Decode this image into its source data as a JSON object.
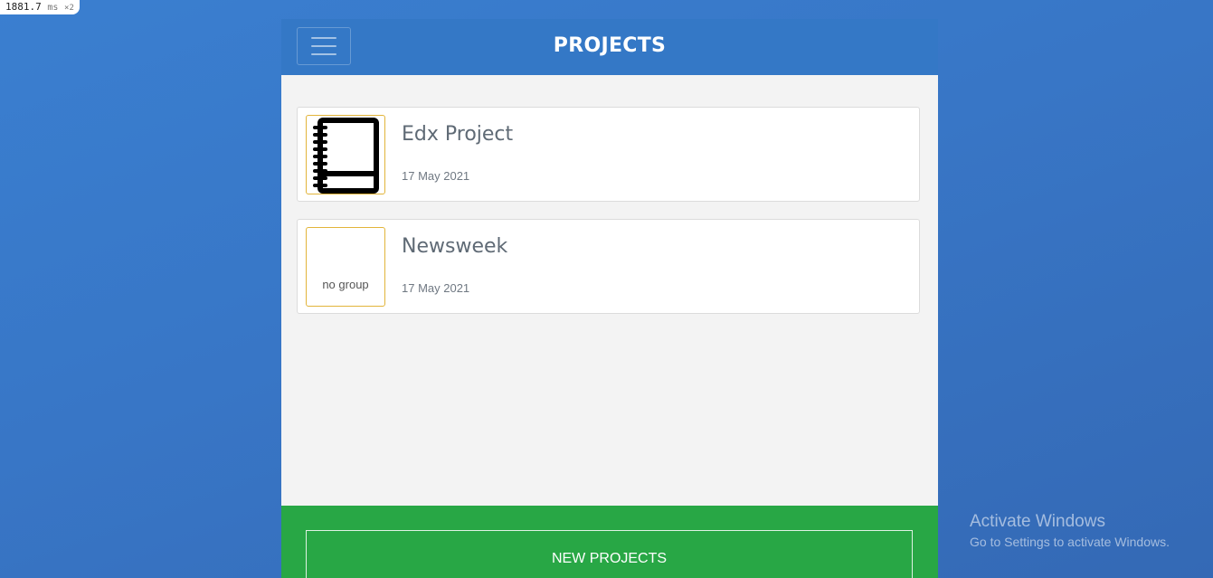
{
  "perf": {
    "value": "1881.7",
    "unit": "ms",
    "multiplier": "×2"
  },
  "header": {
    "title": "PROJECTS",
    "menu_icon": "hamburger-icon"
  },
  "projects": [
    {
      "name": "Edx Project",
      "date": "17 May 2021",
      "thumbnail_icon": "notebook-icon",
      "thumbnail_text": ""
    },
    {
      "name": "Newsweek",
      "date": "17 May 2021",
      "thumbnail_icon": "",
      "thumbnail_text": "no group"
    }
  ],
  "footer": {
    "new_button_label": "NEW PROJECTS"
  },
  "watermark": {
    "title": "Activate Windows",
    "subtitle": "Go to Settings to activate Windows."
  },
  "colors": {
    "header": "#3478c6",
    "footer": "#28a745",
    "thumb_border": "#e2b43a"
  }
}
